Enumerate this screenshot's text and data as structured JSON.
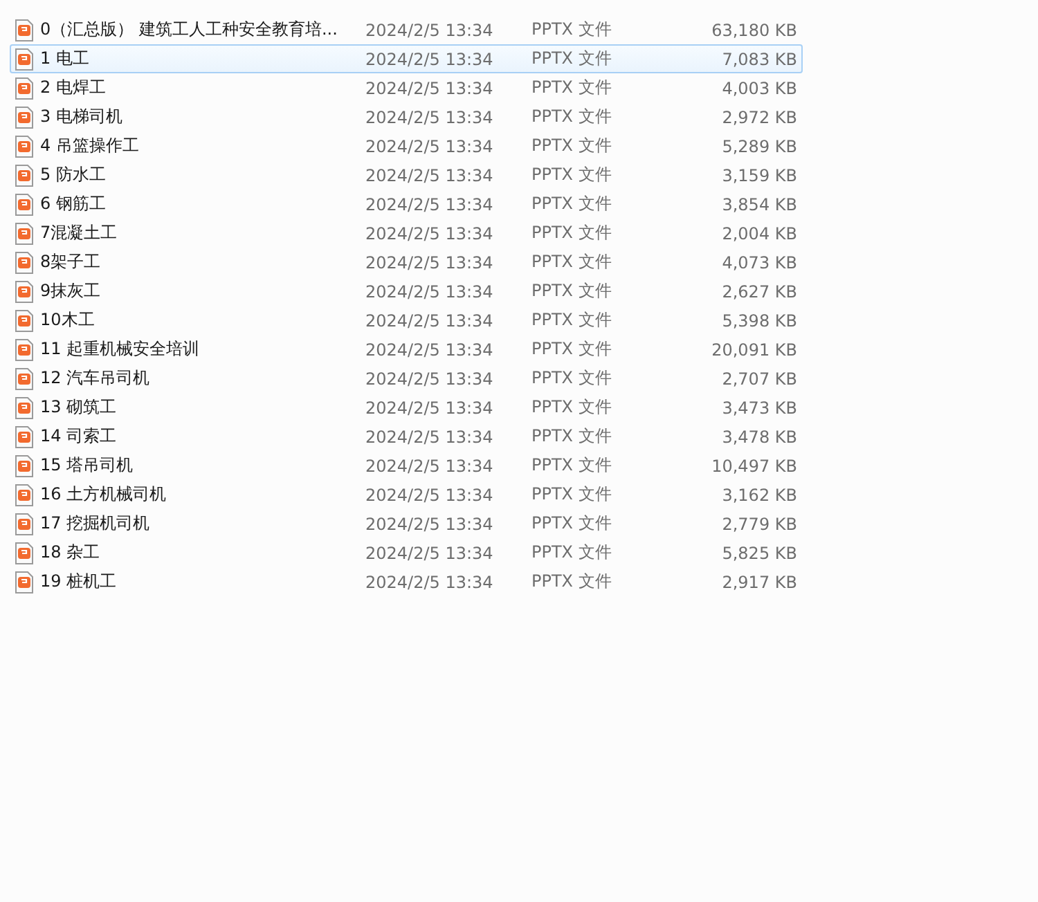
{
  "files": [
    {
      "name": "0（汇总版） 建筑工人工种安全教育培...",
      "date": "2024/2/5 13:34",
      "type": "PPTX 文件",
      "size": "63,180 KB",
      "selected": false
    },
    {
      "name": "1 电工",
      "date": "2024/2/5 13:34",
      "type": "PPTX 文件",
      "size": "7,083 KB",
      "selected": true
    },
    {
      "name": "2 电焊工",
      "date": "2024/2/5 13:34",
      "type": "PPTX 文件",
      "size": "4,003 KB",
      "selected": false
    },
    {
      "name": "3 电梯司机",
      "date": "2024/2/5 13:34",
      "type": "PPTX 文件",
      "size": "2,972 KB",
      "selected": false
    },
    {
      "name": "4 吊篮操作工",
      "date": "2024/2/5 13:34",
      "type": "PPTX 文件",
      "size": "5,289 KB",
      "selected": false
    },
    {
      "name": "5 防水工",
      "date": "2024/2/5 13:34",
      "type": "PPTX 文件",
      "size": "3,159 KB",
      "selected": false
    },
    {
      "name": "6 钢筋工",
      "date": "2024/2/5 13:34",
      "type": "PPTX 文件",
      "size": "3,854 KB",
      "selected": false
    },
    {
      "name": "7混凝土工",
      "date": "2024/2/5 13:34",
      "type": "PPTX 文件",
      "size": "2,004 KB",
      "selected": false
    },
    {
      "name": "8架子工",
      "date": "2024/2/5 13:34",
      "type": "PPTX 文件",
      "size": "4,073 KB",
      "selected": false
    },
    {
      "name": "9抹灰工",
      "date": "2024/2/5 13:34",
      "type": "PPTX 文件",
      "size": "2,627 KB",
      "selected": false
    },
    {
      "name": "10木工",
      "date": "2024/2/5 13:34",
      "type": "PPTX 文件",
      "size": "5,398 KB",
      "selected": false
    },
    {
      "name": "11 起重机械安全培训",
      "date": "2024/2/5 13:34",
      "type": "PPTX 文件",
      "size": "20,091 KB",
      "selected": false
    },
    {
      "name": "12 汽车吊司机",
      "date": "2024/2/5 13:34",
      "type": "PPTX 文件",
      "size": "2,707 KB",
      "selected": false
    },
    {
      "name": "13 砌筑工",
      "date": "2024/2/5 13:34",
      "type": "PPTX 文件",
      "size": "3,473 KB",
      "selected": false
    },
    {
      "name": "14 司索工",
      "date": "2024/2/5 13:34",
      "type": "PPTX 文件",
      "size": "3,478 KB",
      "selected": false
    },
    {
      "name": "15 塔吊司机",
      "date": "2024/2/5 13:34",
      "type": "PPTX 文件",
      "size": "10,497 KB",
      "selected": false
    },
    {
      "name": "16 土方机械司机",
      "date": "2024/2/5 13:34",
      "type": "PPTX 文件",
      "size": "3,162 KB",
      "selected": false
    },
    {
      "name": "17 挖掘机司机",
      "date": "2024/2/5 13:34",
      "type": "PPTX 文件",
      "size": "2,779 KB",
      "selected": false
    },
    {
      "name": "18 杂工",
      "date": "2024/2/5 13:34",
      "type": "PPTX 文件",
      "size": "5,825 KB",
      "selected": false
    },
    {
      "name": "19 桩机工",
      "date": "2024/2/5 13:34",
      "type": "PPTX 文件",
      "size": "2,917 KB",
      "selected": false
    }
  ]
}
